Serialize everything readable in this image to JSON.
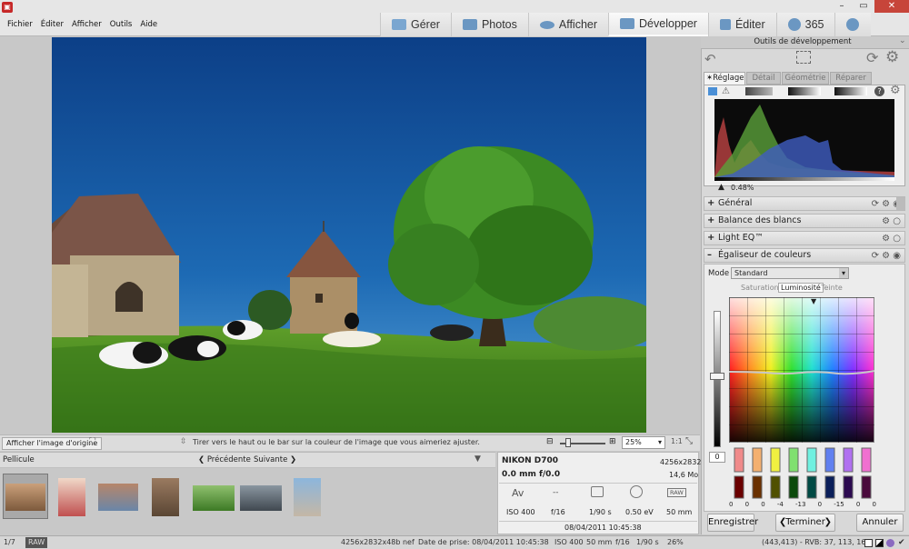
{
  "menu": [
    "Fichier",
    "Éditer",
    "Afficher",
    "Outils",
    "Aide"
  ],
  "modes": [
    {
      "label": "Gérer",
      "icon": "grid-icon"
    },
    {
      "label": "Photos",
      "icon": "photos-icon"
    },
    {
      "label": "Afficher",
      "icon": "eye-icon"
    },
    {
      "label": "Développer",
      "icon": "develop-icon"
    },
    {
      "label": "Éditer",
      "icon": "tools-icon"
    },
    {
      "label": "365",
      "icon": "cloud-365-icon"
    }
  ],
  "viewer": {
    "show_original": "Afficher l'image d'origine",
    "hint": "Tirer vers le haut ou le bar sur la couleur de l'image que vous aimeriez ajuster.",
    "zoom": "25%",
    "ratio": "1:1"
  },
  "filmstrip": {
    "title": "Pellicule",
    "prev": "Précédente",
    "next": "Suivante"
  },
  "info": {
    "camera": "NIKON D700",
    "dimensions": "4256x2832",
    "lens": "0.0 mm f/0.0",
    "size": "14,6 Mo",
    "av": "Av",
    "ev_dash": "--",
    "exp_raw": "RAW",
    "iso": "ISO 400",
    "aperture": "f/16",
    "shutter": "1/90 s",
    "ev": "0.50 eV",
    "focal": "50 mm",
    "date": "08/04/2011 10:45:38"
  },
  "panel": {
    "title": "Outils de développement",
    "tabs": [
      "Réglage",
      "Détail",
      "Géométrie",
      "Réparer"
    ],
    "clip": "0.48%",
    "sections": [
      "Général",
      "Balance des blancs",
      "Light EQ™",
      "Égaliseur de couleurs"
    ],
    "mode_label": "Mode",
    "mode_value": "Standard",
    "subtabs": [
      "Saturation",
      "Luminosité",
      "Teinte"
    ],
    "eq_values": [
      "0",
      "0",
      "0",
      "-4",
      "-13",
      "0",
      "-15",
      "0",
      "0"
    ],
    "slider_value": "0"
  },
  "buttons": {
    "save": "Enregistrer",
    "done": "Terminer",
    "cancel": "Annuler"
  },
  "status": {
    "count": "1/7",
    "raw": "RAW",
    "file": "4256x2832x48b nef",
    "date": "Date de prise: 08/04/2011 10:45:38",
    "iso": "ISO 400",
    "focal": "50 mm",
    "fstop": "f/16",
    "shutter": "1/90 s",
    "zoom": "26%",
    "coords": "(443,413) - RVB: 37, 113, 161"
  }
}
